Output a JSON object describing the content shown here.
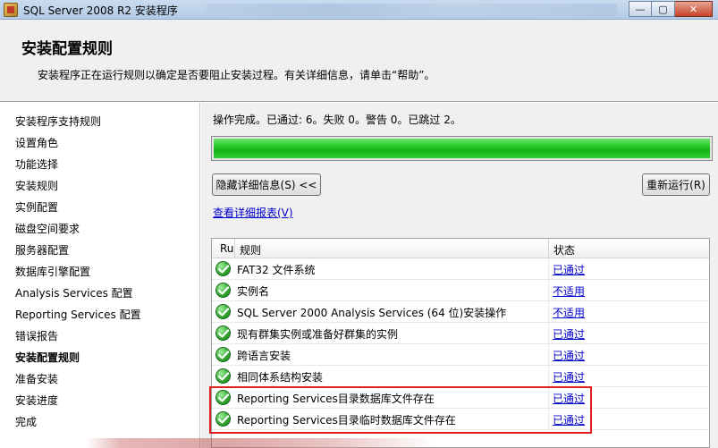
{
  "window": {
    "title": "SQL Server 2008 R2 安装程序",
    "controls": {
      "minimize": "—",
      "maximize": "▢",
      "close": "✕"
    }
  },
  "header": {
    "title": "安装配置规则",
    "subtitle": "安装程序正在运行规则以确定是否要阻止安装过程。有关详细信息，请单击“帮助”。"
  },
  "sidebar": {
    "items": [
      {
        "label": "安装程序支持规则",
        "active": false
      },
      {
        "label": "设置角色",
        "active": false
      },
      {
        "label": "功能选择",
        "active": false
      },
      {
        "label": "安装规则",
        "active": false
      },
      {
        "label": "实例配置",
        "active": false
      },
      {
        "label": "磁盘空间要求",
        "active": false
      },
      {
        "label": "服务器配置",
        "active": false
      },
      {
        "label": "数据库引擎配置",
        "active": false
      },
      {
        "label": "Analysis Services 配置",
        "active": false
      },
      {
        "label": "Reporting Services 配置",
        "active": false
      },
      {
        "label": "错误报告",
        "active": false
      },
      {
        "label": "安装配置规则",
        "active": true
      },
      {
        "label": "准备安装",
        "active": false
      },
      {
        "label": "安装进度",
        "active": false
      },
      {
        "label": "完成",
        "active": false
      }
    ]
  },
  "main": {
    "status": "操作完成。已通过: 6。失败 0。警告 0。已跳过 2。",
    "progress_percent": 100,
    "hide_details_button": "隐藏详细信息(S) <<",
    "rerun_button": "重新运行(R)",
    "report_link": "查看详细报表(V)",
    "table": {
      "headers": {
        "ru": "Ru",
        "rule": "规则",
        "status": "状态"
      },
      "rows": [
        {
          "icon": "check-icon",
          "rule": "FAT32 文件系统",
          "status": "已通过"
        },
        {
          "icon": "check-icon",
          "rule": "实例名",
          "status": "不适用"
        },
        {
          "icon": "check-icon",
          "rule": "SQL Server 2000 Analysis Services (64 位)安装操作",
          "status": "不适用"
        },
        {
          "icon": "check-icon",
          "rule": "现有群集实例或准备好群集的实例",
          "status": "已通过"
        },
        {
          "icon": "check-icon",
          "rule": "跨语言安装",
          "status": "已通过"
        },
        {
          "icon": "check-icon",
          "rule": "相同体系结构安装",
          "status": "已通过"
        },
        {
          "icon": "check-icon",
          "rule": "Reporting Services目录数据库文件存在",
          "status": "已通过"
        },
        {
          "icon": "check-icon",
          "rule": "Reporting Services目录临时数据库文件存在",
          "status": "已通过"
        }
      ]
    }
  },
  "colors": {
    "accent_progress": "#1db81d",
    "link": "#0000cc",
    "highlight": "#e02020"
  }
}
